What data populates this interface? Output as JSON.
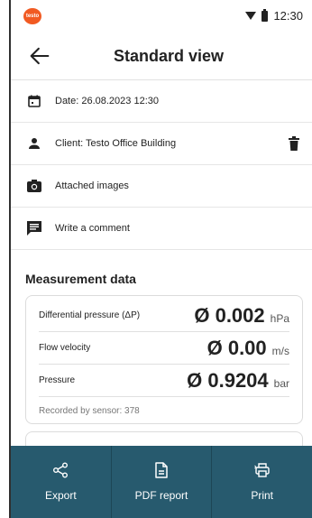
{
  "statusbar": {
    "logo_text": "testo",
    "time": "12:30"
  },
  "header": {
    "title": "Standard view",
    "back_icon": "arrow-left-icon"
  },
  "info_rows": [
    {
      "icon": "calendar-icon",
      "text": "Date: 26.08.2023 12:30"
    },
    {
      "icon": "person-icon",
      "text": "Client: Testo Office Building"
    },
    {
      "icon": "camera-icon",
      "text": "Attached images"
    },
    {
      "icon": "comment-icon",
      "text": "Write a comment"
    }
  ],
  "measurement": {
    "title": "Measurement data",
    "rows": [
      {
        "label": "Differential pressure (ΔP)",
        "value": "Ø 0.002",
        "unit": "hPa"
      },
      {
        "label": "Flow velocity",
        "value": "Ø 0.00",
        "unit": "m/s"
      },
      {
        "label": "Pressure",
        "value": "Ø 0.9204",
        "unit": "bar"
      }
    ],
    "footer": "Recorded by sensor: 378"
  },
  "bottom_bar": {
    "export_label": "Export",
    "pdf_label": "PDF report",
    "print_label": "Print"
  },
  "colors": {
    "bottom_bar": "#275a6e",
    "logo": "#f15a22"
  }
}
